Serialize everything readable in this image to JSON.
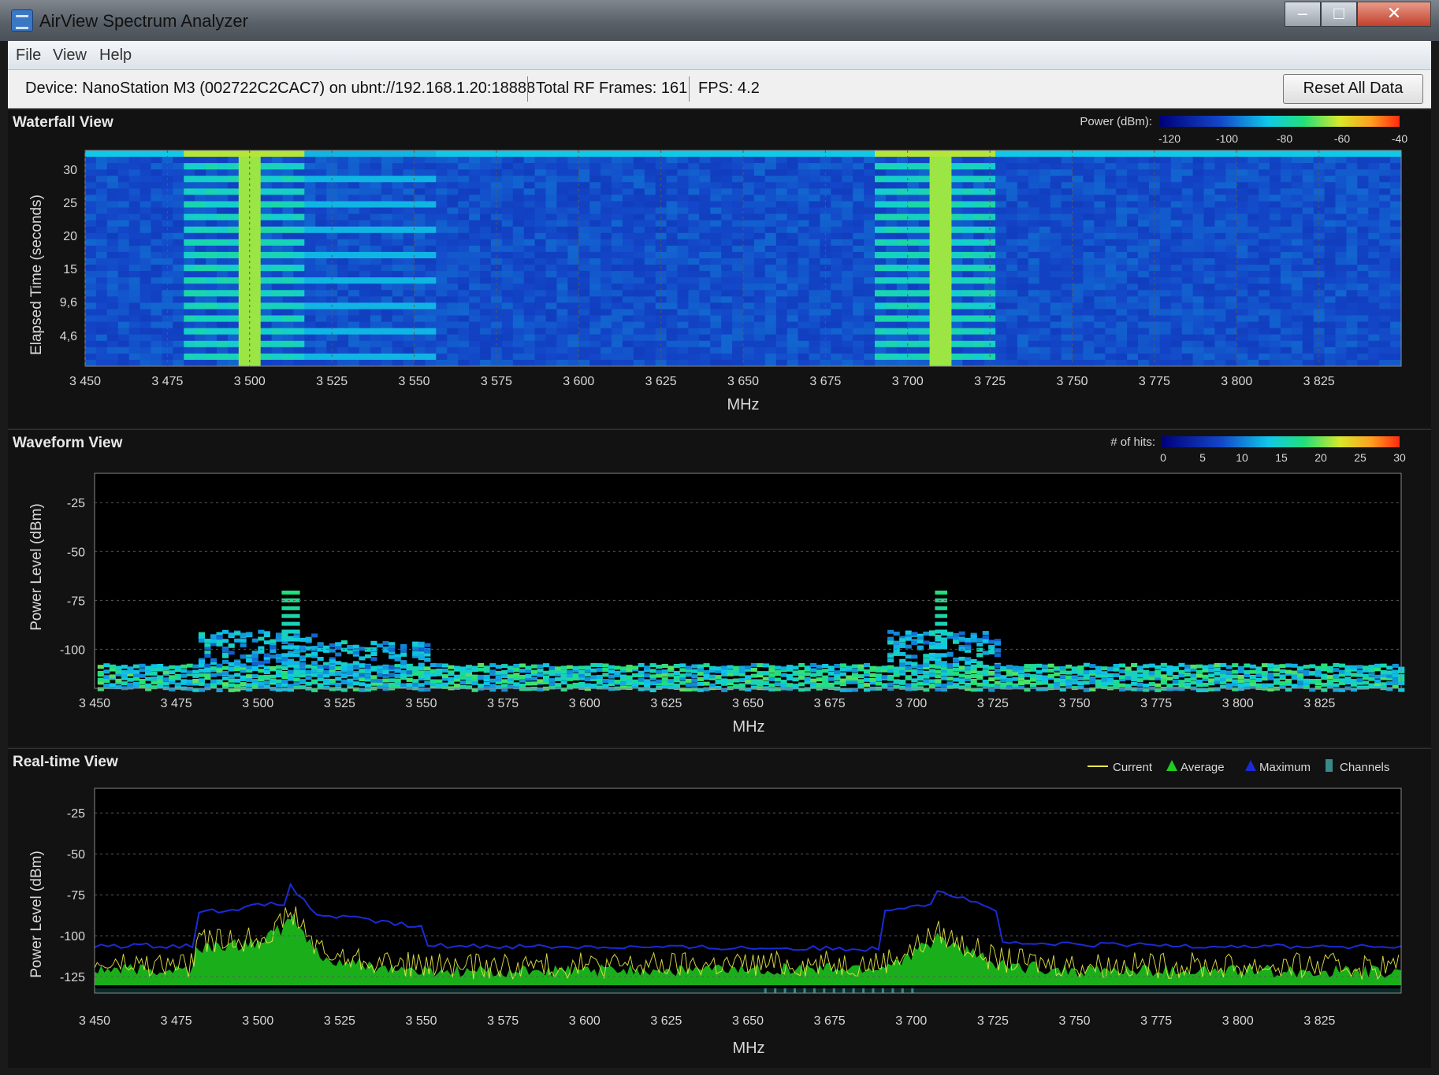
{
  "window": {
    "title": "AirView Spectrum Analyzer",
    "min": "–",
    "max": "□",
    "close": "✕"
  },
  "menu": [
    "File",
    "View",
    "Help"
  ],
  "toolbar": {
    "device": "Device: NanoStation M3 (002722C2CAC7) on ubnt://192.168.1.20:18888",
    "frames": "Total RF Frames: 161",
    "fps": "FPS: 4.2",
    "reset_label": "Reset All Data"
  },
  "colors": {
    "panel_bg": "#121212",
    "grid": "#5a5a5a",
    "axis_text": "#d8d8d8",
    "current": "#e8e84a",
    "average": "#1fcc1f",
    "maximum": "#1a2bd6",
    "channels": "#3a8a8a"
  },
  "freq_ticks": [
    "3 450",
    "3 475",
    "3 500",
    "3 525",
    "3 550",
    "3 575",
    "3 600",
    "3 625",
    "3 650",
    "3 675",
    "3 700",
    "3 725",
    "3 750",
    "3 775",
    "3 800",
    "3 825"
  ],
  "waterfall": {
    "title": "Waterfall View",
    "ylabel": "Elapsed Time (seconds)",
    "xlabel": "MHz",
    "yticks": [
      "30",
      "25",
      "20",
      "15",
      "9,6",
      "4,6"
    ],
    "legend_label": "Power (dBm):",
    "legend_ticks": [
      "-120",
      "-100",
      "-80",
      "-60",
      "-40"
    ]
  },
  "waveform": {
    "title": "Waveform View",
    "ylabel": "Power Level (dBm)",
    "xlabel": "MHz",
    "yticks": [
      "-25",
      "-50",
      "-75",
      "-100"
    ],
    "legend_label": "# of hits:",
    "legend_ticks": [
      "0",
      "5",
      "10",
      "15",
      "20",
      "25",
      "30"
    ]
  },
  "realtime": {
    "title": "Real-time View",
    "ylabel": "Power Level (dBm)",
    "xlabel": "MHz",
    "yticks": [
      "-25",
      "-50",
      "-75",
      "-100",
      "-125"
    ],
    "legend": [
      {
        "label": "Current",
        "icon": "line"
      },
      {
        "label": "Average",
        "icon": "triangle"
      },
      {
        "label": "Maximum",
        "icon": "triangle"
      },
      {
        "label": "Channels",
        "icon": "bar"
      }
    ]
  },
  "chart_data": [
    {
      "type": "heatmap",
      "title": "Waterfall View",
      "xlabel": "MHz",
      "ylabel": "Elapsed Time (seconds)",
      "xlim": [
        3450,
        3850
      ],
      "ylim": [
        0,
        33
      ],
      "color_scale": [
        -120,
        -40
      ],
      "bands": [
        {
          "start": 3481,
          "end": 3517
        },
        {
          "start": 3691,
          "end": 3726
        }
      ]
    },
    {
      "type": "heatmap",
      "title": "Waveform View",
      "xlabel": "MHz",
      "ylabel": "Power Level (dBm)",
      "xlim": [
        3450,
        3850
      ],
      "ylim": [
        -120,
        -10
      ],
      "color_scale": [
        0,
        30
      ]
    },
    {
      "type": "line",
      "title": "Real-time View",
      "xlabel": "MHz",
      "ylabel": "Power Level (dBm)",
      "xlim": [
        3450,
        3850
      ],
      "ylim": [
        -135,
        -10
      ],
      "series": [
        {
          "name": "Maximum",
          "x": [
            3450,
            3480,
            3481,
            3508,
            3510,
            3517,
            3518,
            3540,
            3550,
            3551,
            3690,
            3691,
            3706,
            3708,
            3726,
            3727,
            3850
          ],
          "y": [
            -106,
            -106,
            -86,
            -80,
            -70,
            -85,
            -87,
            -92,
            -95,
            -106,
            -108,
            -84,
            -80,
            -72,
            -84,
            -105,
            -107
          ]
        },
        {
          "name": "Average",
          "x": [
            3450,
            3480,
            3481,
            3500,
            3508,
            3510,
            3517,
            3520,
            3550,
            3690,
            3700,
            3708,
            3720,
            3726,
            3750,
            3850
          ],
          "y": [
            -121,
            -121,
            -108,
            -104,
            -95,
            -87,
            -108,
            -115,
            -122,
            -120,
            -112,
            -101,
            -112,
            -118,
            -121,
            -122
          ]
        }
      ]
    }
  ]
}
